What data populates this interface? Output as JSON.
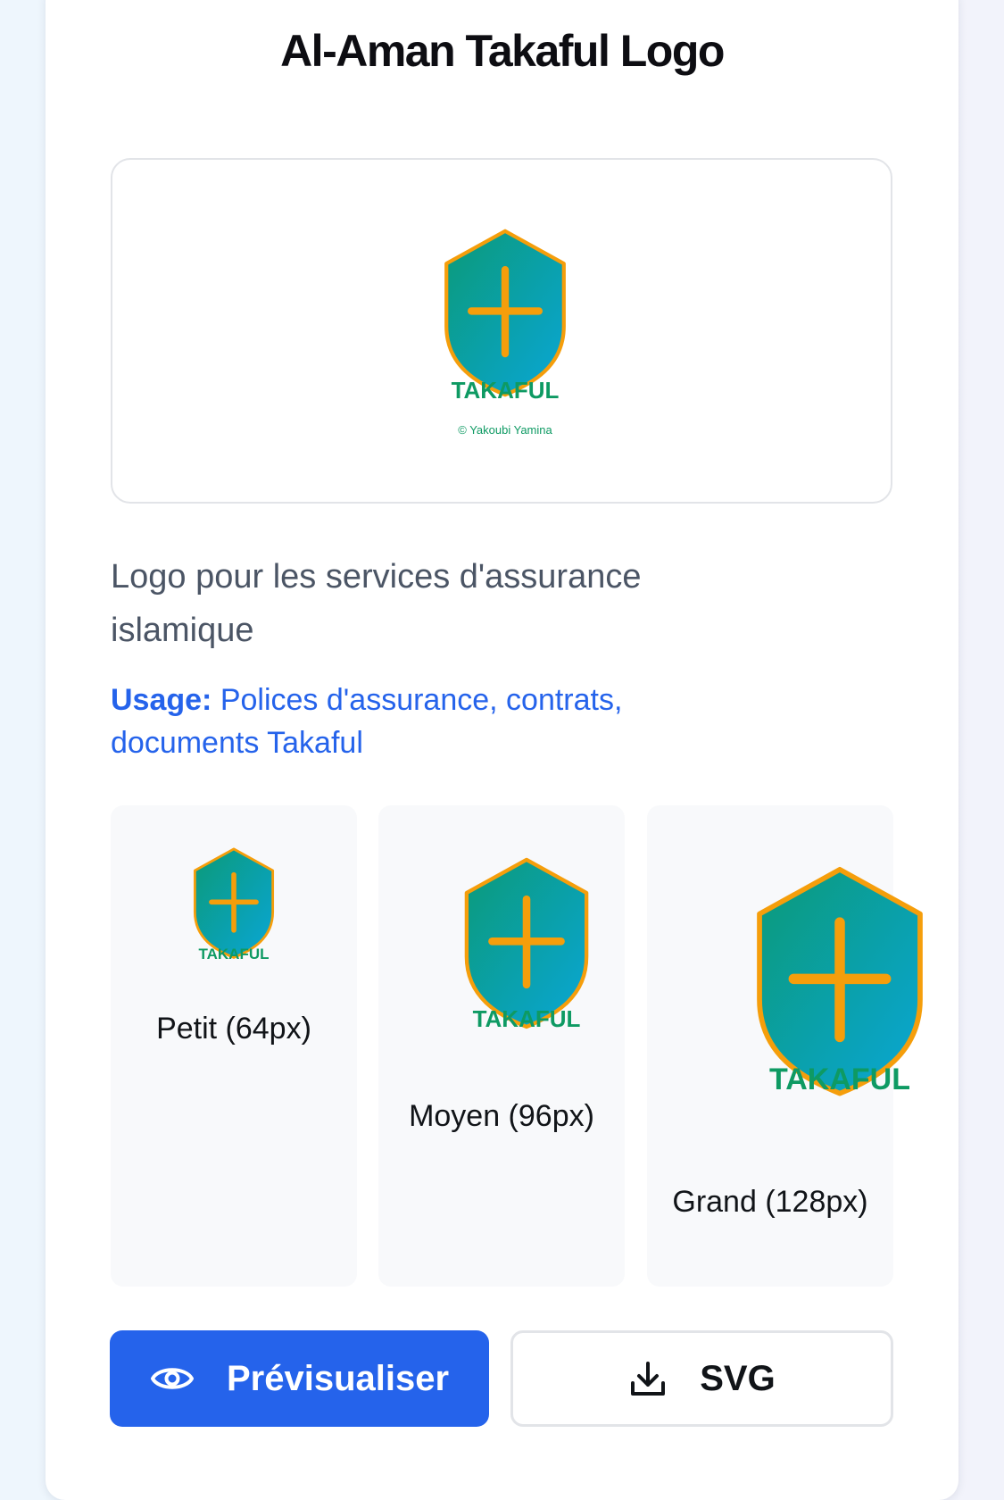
{
  "title": "Al-Aman Takaful Logo",
  "logo": {
    "wordmark": "TAKAFUL",
    "copyright": "© Yakoubi Yamina",
    "icon": "shield-cross-icon",
    "colors": {
      "gradient_start": "#0b9a78",
      "gradient_end": "#0aa6d6",
      "outline": "#f59e0b",
      "cross": "#f59e0b",
      "wordmark": "#0e9a63"
    }
  },
  "description": "Logo pour les services d'assurance islamique",
  "usage": {
    "label": "Usage:",
    "text": "Polices d'assurance, contrats, documents Takaful"
  },
  "sizes": [
    {
      "label": "Petit (64px)"
    },
    {
      "label": "Moyen (96px)"
    },
    {
      "label": "Grand (128px)"
    }
  ],
  "actions": {
    "preview": {
      "label": "Prévisualiser",
      "icon": "eye-icon"
    },
    "download": {
      "label": "SVG",
      "icon": "download-icon"
    }
  },
  "colors": {
    "primary": "#2563eb",
    "title": "#0d0d12",
    "description": "#4b5565"
  }
}
